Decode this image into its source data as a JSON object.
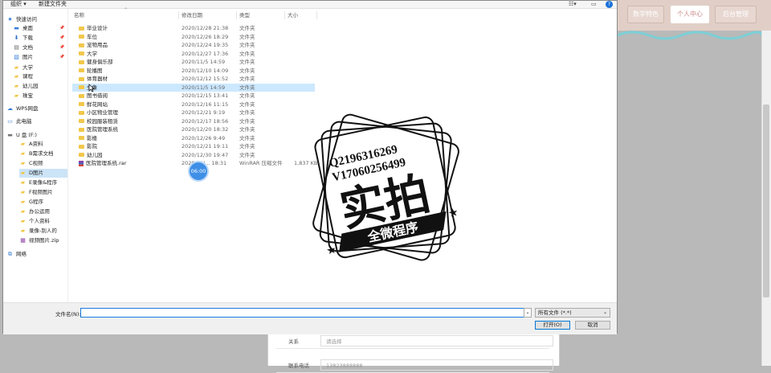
{
  "topnav": {
    "items": [
      "数学特色",
      "个人中心",
      "后台管理"
    ]
  },
  "background_form": {
    "relation_label": "关系",
    "relation_placeholder": "请选择",
    "next_label": "联系电话",
    "next_value": "13823888888"
  },
  "dialog": {
    "toolbar": {
      "organize": "组织 ▾",
      "new_folder": "新建文件夹",
      "help": "?"
    },
    "nav": [
      {
        "label": "快速访问",
        "icon": "star-icon",
        "pinned": false,
        "selected": false,
        "indent": 0
      },
      {
        "label": "桌面",
        "icon": "desktop-icon",
        "pinned": true,
        "selected": false,
        "indent": 1
      },
      {
        "label": "下载",
        "icon": "download-icon",
        "pinned": true,
        "selected": false,
        "indent": 1
      },
      {
        "label": "文档",
        "icon": "document-icon",
        "pinned": true,
        "selected": false,
        "indent": 1
      },
      {
        "label": "图片",
        "icon": "picture-icon",
        "pinned": true,
        "selected": false,
        "indent": 1
      },
      {
        "label": "大学",
        "icon": "folder-icon",
        "pinned": false,
        "selected": false,
        "indent": 1
      },
      {
        "label": "课程",
        "icon": "folder-icon",
        "pinned": false,
        "selected": false,
        "indent": 1
      },
      {
        "label": "幼儿园",
        "icon": "folder-icon",
        "pinned": false,
        "selected": false,
        "indent": 1
      },
      {
        "label": "珠宝",
        "icon": "folder-icon",
        "pinned": false,
        "selected": false,
        "indent": 1
      },
      {
        "label": "WPS网盘",
        "icon": "cloud-icon",
        "pinned": false,
        "selected": false,
        "indent": 0
      },
      {
        "label": "此电脑",
        "icon": "computer-icon",
        "pinned": false,
        "selected": false,
        "indent": 0
      },
      {
        "label": "U 盘 (F:)",
        "icon": "drive-icon",
        "pinned": false,
        "selected": false,
        "indent": 0
      },
      {
        "label": "A资料",
        "icon": "folder-icon",
        "pinned": false,
        "selected": false,
        "indent": 2
      },
      {
        "label": "B需求文档",
        "icon": "folder-icon",
        "pinned": false,
        "selected": false,
        "indent": 2
      },
      {
        "label": "C视频",
        "icon": "folder-icon",
        "pinned": false,
        "selected": false,
        "indent": 2
      },
      {
        "label": "D图片",
        "icon": "folder-icon",
        "pinned": false,
        "selected": true,
        "indent": 2
      },
      {
        "label": "E录像&程序",
        "icon": "folder-icon",
        "pinned": false,
        "selected": false,
        "indent": 2
      },
      {
        "label": "F视频图片",
        "icon": "folder-icon",
        "pinned": false,
        "selected": false,
        "indent": 2
      },
      {
        "label": "G程序",
        "icon": "folder-icon",
        "pinned": false,
        "selected": false,
        "indent": 2
      },
      {
        "label": "办公运用",
        "icon": "folder-icon",
        "pinned": false,
        "selected": false,
        "indent": 2
      },
      {
        "label": "个人资料",
        "icon": "folder-icon",
        "pinned": false,
        "selected": false,
        "indent": 2
      },
      {
        "label": "录像-别人的",
        "icon": "folder-icon",
        "pinned": false,
        "selected": false,
        "indent": 2
      },
      {
        "label": "视频图片.zip",
        "icon": "zip-icon",
        "pinned": false,
        "selected": false,
        "indent": 2
      },
      {
        "label": "网络",
        "icon": "network-icon",
        "pinned": false,
        "selected": false,
        "indent": 0
      }
    ],
    "columns": {
      "name": "名称",
      "modified": "修改日期",
      "type": "类型",
      "size": "大小"
    },
    "files": [
      {
        "name": "毕业设计",
        "modified": "2020/12/28 21:38",
        "type": "文件夹",
        "size": "",
        "kind": "folder",
        "selected": false
      },
      {
        "name": "车位",
        "modified": "2020/12/26 18:29",
        "type": "文件夹",
        "size": "",
        "kind": "folder",
        "selected": false
      },
      {
        "name": "宠物用品",
        "modified": "2020/12/24 19:35",
        "type": "文件夹",
        "size": "",
        "kind": "folder",
        "selected": false
      },
      {
        "name": "大学",
        "modified": "2020/12/27 17:36",
        "type": "文件夹",
        "size": "",
        "kind": "folder",
        "selected": false
      },
      {
        "name": "健身俱乐部",
        "modified": "2020/11/5 14:59",
        "type": "文件夹",
        "size": "",
        "kind": "folder",
        "selected": false
      },
      {
        "name": "轮播图",
        "modified": "2020/12/10 14:09",
        "type": "文件夹",
        "size": "",
        "kind": "folder",
        "selected": false
      },
      {
        "name": "体育器材",
        "modified": "2020/12/12 15:52",
        "type": "文件夹",
        "size": "",
        "kind": "folder",
        "selected": false
      },
      {
        "name": "头像",
        "modified": "2020/11/5 14:59",
        "type": "文件夹",
        "size": "",
        "kind": "folder",
        "selected": true
      },
      {
        "name": "图书借阅",
        "modified": "2020/12/15 13:41",
        "type": "文件夹",
        "size": "",
        "kind": "folder",
        "selected": false
      },
      {
        "name": "鲜花网站",
        "modified": "2020/12/16 11:15",
        "type": "文件夹",
        "size": "",
        "kind": "folder",
        "selected": false
      },
      {
        "name": "小区物业管理",
        "modified": "2020/12/21 9:19",
        "type": "文件夹",
        "size": "",
        "kind": "folder",
        "selected": false
      },
      {
        "name": "校园服装租赁",
        "modified": "2020/12/17 18:56",
        "type": "文件夹",
        "size": "",
        "kind": "folder",
        "selected": false
      },
      {
        "name": "医院管理系统",
        "modified": "2020/12/20 18:32",
        "type": "文件夹",
        "size": "",
        "kind": "folder",
        "selected": false
      },
      {
        "name": "影楼",
        "modified": "2020/12/26 9:49",
        "type": "文件夹",
        "size": "",
        "kind": "folder",
        "selected": false
      },
      {
        "name": "影院",
        "modified": "2020/12/21 19:11",
        "type": "文件夹",
        "size": "",
        "kind": "folder",
        "selected": false
      },
      {
        "name": "幼儿园",
        "modified": "2020/12/30 19:47",
        "type": "文件夹",
        "size": "",
        "kind": "folder",
        "selected": false
      },
      {
        "name": "医院管理系统.rar",
        "modified": "2020/12/... 18:31",
        "type": "WinRAR 压缩文件",
        "size": "1,837 KB",
        "kind": "rar",
        "selected": false
      }
    ],
    "filename_label": "文件名(N):",
    "filename_value": "",
    "filter_value": "所有文件 (*.*)",
    "open_button": "打开(O)",
    "cancel_button": "取消"
  },
  "timer": "06:00",
  "watermark": {
    "line1": "Q2196316269",
    "line2": "V1706025649​9",
    "main": "实拍",
    "banner": "全微程序"
  },
  "colors": {
    "selection": "#cce8ff",
    "accent": "#0078d7",
    "topbar": "#e1cfc7",
    "folder": "#f2c84b"
  }
}
